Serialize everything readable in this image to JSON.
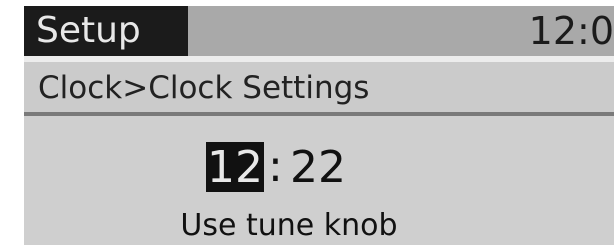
{
  "header": {
    "title": "Setup",
    "clock": "12:0"
  },
  "breadcrumb": "Clock>Clock Settings",
  "time": {
    "hour": "12",
    "separator": ":",
    "minutes": "22"
  },
  "hint": "Use tune knob"
}
